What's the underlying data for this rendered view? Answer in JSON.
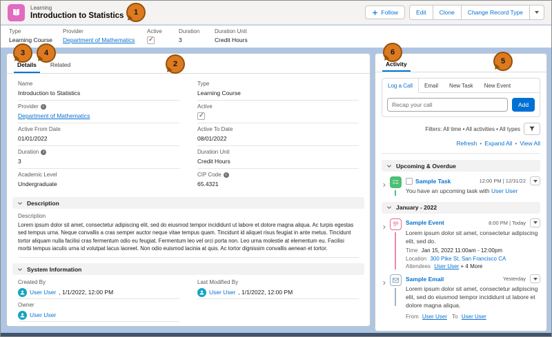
{
  "colors": {
    "brand_blue": "#0670CF",
    "button_blue": "#0070D2",
    "background_blue": "#AEC6E4",
    "badge_orange": "#DD7A1F",
    "task_green": "#4BC076",
    "event_pink": "#E8688E",
    "email_steel": "#95AEC5",
    "avatar_teal": "#14A5C0",
    "learning_pink": "#E26ABF"
  },
  "header": {
    "object_label": "Learning",
    "title": "Introduction to Statistics",
    "actions": {
      "follow": "Follow",
      "edit": "Edit",
      "clone": "Clone",
      "change_record_type": "Change Record Type"
    }
  },
  "highlights": {
    "fields": [
      {
        "label": "Type",
        "value": "Learning Course"
      },
      {
        "label": "Provider",
        "value": "Department of Mathematics"
      },
      {
        "label": "Active",
        "value": "checked"
      },
      {
        "label": "Duration",
        "value": "3"
      },
      {
        "label": "Duration Unit",
        "value": "Credit Hours"
      }
    ]
  },
  "details": {
    "tabs": {
      "details": "Details",
      "related": "Related"
    },
    "fields": [
      {
        "label": "Name",
        "value": "Introduction to Statistics"
      },
      {
        "label": "Type",
        "value": "Learning Course"
      },
      {
        "label": "Provider",
        "value": "Department of Mathematics"
      },
      {
        "label": "Active",
        "value": "checked"
      },
      {
        "label": "Active From Date",
        "value": "01/01/2022"
      },
      {
        "label": "Active To Date",
        "value": "08/01/2022"
      },
      {
        "label": "Duration",
        "value": "3"
      },
      {
        "label": "Duration Unit",
        "value": "Credit Hours"
      },
      {
        "label": "Academic Level",
        "value": "Undergraduate"
      },
      {
        "label": "CIP Code",
        "value": "65.4321"
      }
    ],
    "description_section": {
      "title": "Description",
      "field_label": "Description",
      "text": "Lorem ipsum dolor sit amet, consectetur adipiscing elit, sed do eiusmod tempor incididunt ut labore et dolore magna aliqua. Ac turpis egestas sed tempus urna. Neque convallis a cras semper auctor neque vitae tempus quam. Tincidunt id aliquet risus feugiat in ante metus. Tincidunt tortor aliquam nulla facilisi cras fermentum odio eu feugiat. Fermentum leo vel orci porta non. Leo urna molestie at elementum eu. Facilisi morbi tempus iaculis urna id volutpat lacus laoreet. Non odio euismod lacinia at quis. Ac tortor dignissim convallis aenean et tortor."
    },
    "system_section": {
      "title": "System Information",
      "created_by": {
        "label": "Created By",
        "user": "User User",
        "timestamp": ", 1/1/2022, 12:00 PM"
      },
      "last_modified_by": {
        "label": "Last Modified By",
        "user": "User User",
        "timestamp": ", 1/1/2022, 12:00 PM"
      },
      "owner": {
        "label": "Owner",
        "user": "User User"
      }
    }
  },
  "activity": {
    "tab": "Activity",
    "composer": {
      "tabs": [
        "Log a Call",
        "Email",
        "New Task",
        "New Event"
      ],
      "placeholder": "Recap your call",
      "add_button": "Add"
    },
    "filters": "Filters: All time • All activities • All types",
    "links": {
      "refresh": "Refresh",
      "expand_all": "Expand All",
      "view_all": "View All",
      "separator": "•"
    },
    "sections": {
      "upcoming": "Upcoming & Overdue",
      "january": "January - 2022"
    },
    "task": {
      "title": "Sample Task",
      "meta": "12:00 PM | 12/31/22",
      "body_prefix": "You have an upcoming task with",
      "body_link": "User User"
    },
    "event": {
      "title": "Sample Event",
      "meta": "8:00 PM | Today",
      "body": "Lorem ipsum dolor sit amet, consectetur adipiscing elit, sed do.",
      "time_label": "Time",
      "time_value": "Jan 15, 2022  11:00am - 12:00pm",
      "location_label": "Location",
      "location_value": "300 Pike St, San Francisco CA",
      "attendees_label": "Attendees",
      "attendees_link": "User User",
      "attendees_more": "+ 4 More"
    },
    "email": {
      "title": "Sample Email",
      "meta": "Yesterday",
      "body": "Lorem ipsum dolor sit amet, consectetur adipiscing elit, sed do eiusmod tempor incididunt ut labore et dolore magna aliqua.",
      "from_label": "From",
      "from_link": "User User",
      "to_label": "To",
      "to_link": "User User"
    }
  },
  "annotations": {
    "b1": "1",
    "b2": "2",
    "b3": "3",
    "b4": "4",
    "b5": "5",
    "b6": "6"
  }
}
